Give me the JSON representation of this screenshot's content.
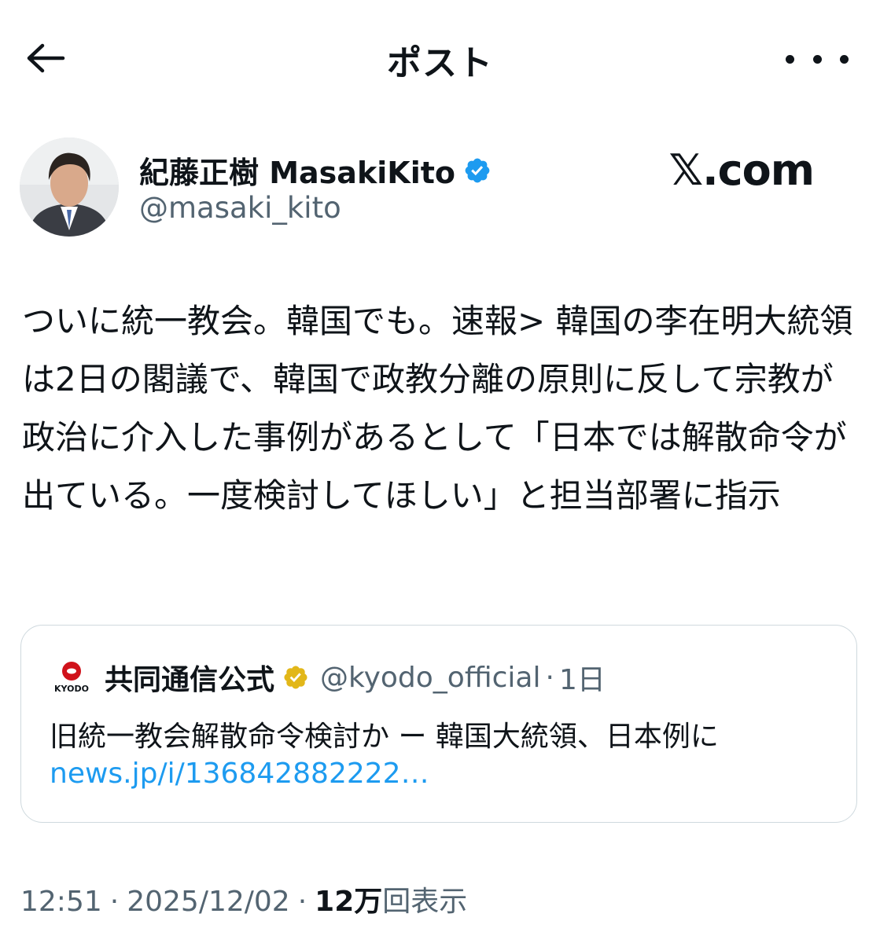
{
  "header": {
    "title": "ポスト"
  },
  "author": {
    "display_name": "紀藤正樹 MasakiKito",
    "handle": "@masaki_kito",
    "verified": true
  },
  "watermark": "𝕏.com",
  "tweet": {
    "text": "ついに統一教会。韓国でも。速報> 韓国の李在明大統領は2日の閣議で、韓国で政教分離の原則に反して宗教が政治に介入した事例があるとして「日本では解散命令が出ている。一度検討してほしい」と担当部署に指示"
  },
  "quote": {
    "logo_text": "KYODO",
    "name": "共同通信公式",
    "handle": "@kyodo_official",
    "separator": "·",
    "time": "1日",
    "text": "旧統一教会解散命令検討か ー 韓国大統領、日本例に",
    "link": "news.jp/i/136842882222…"
  },
  "meta": {
    "time": "12:51",
    "date": "2025/12/02",
    "views_count": "12万",
    "views_label": "回表示"
  },
  "colors": {
    "text": "#0f1419",
    "secondary": "#536471",
    "link": "#1d9bf0",
    "verified_blue": "#1d9bf0",
    "verified_gold": "#e2b719",
    "border": "#cfd9de",
    "kyodo_red": "#d0121b"
  },
  "icons": {
    "back": "arrow-left-icon",
    "more": "more-horizontal-icon",
    "verified": "verified-badge-icon",
    "gold_badge": "gold-verified-badge-icon"
  }
}
